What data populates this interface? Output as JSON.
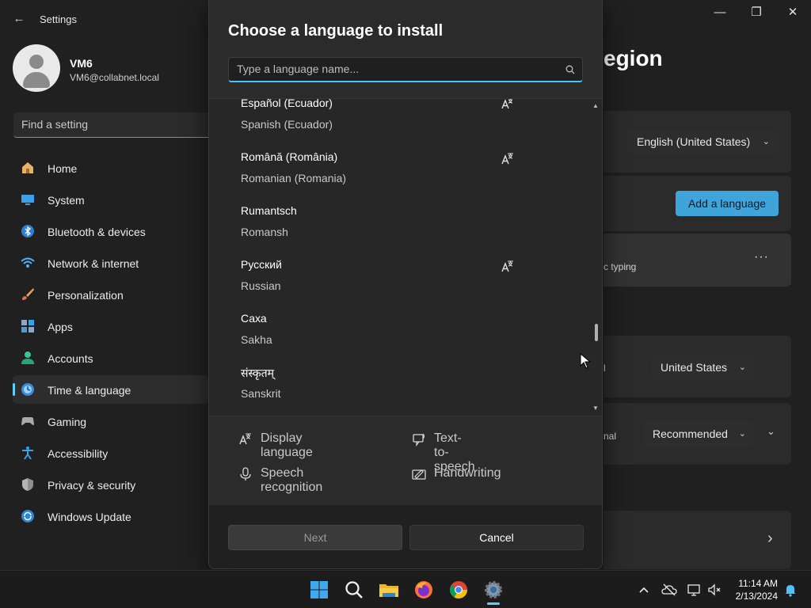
{
  "window": {
    "title": "Settings",
    "back_glyph": "←",
    "minimize_glyph": "—",
    "maximize_glyph": "❐",
    "close_glyph": "✕"
  },
  "profile": {
    "name": "VM6",
    "email": "VM6@collabnet.local"
  },
  "search": {
    "placeholder": "Find a setting"
  },
  "sidebar": {
    "items": [
      {
        "label": "Home",
        "icon": "home-icon"
      },
      {
        "label": "System",
        "icon": "system-icon"
      },
      {
        "label": "Bluetooth & devices",
        "icon": "bluetooth-icon"
      },
      {
        "label": "Network & internet",
        "icon": "wifi-icon"
      },
      {
        "label": "Personalization",
        "icon": "brush-icon"
      },
      {
        "label": "Apps",
        "icon": "apps-icon"
      },
      {
        "label": "Accounts",
        "icon": "accounts-icon"
      },
      {
        "label": "Time & language",
        "icon": "time-language-icon",
        "selected": true
      },
      {
        "label": "Gaming",
        "icon": "gaming-icon"
      },
      {
        "label": "Accessibility",
        "icon": "accessibility-icon"
      },
      {
        "label": "Privacy & security",
        "icon": "shield-icon"
      },
      {
        "label": "Windows Update",
        "icon": "windows-update-icon"
      }
    ]
  },
  "background_page": {
    "heading_fragment": "egion",
    "display_language_value": "English (United States)",
    "add_language_label": "Add a language",
    "typing_fragment": "c typing",
    "more_glyph": "···",
    "region_value": "United States",
    "region_fragment": "l",
    "format_fragment": "nal",
    "format_value": "Recommended",
    "chevron_down_glyph": "⌄",
    "chevron_right_glyph": "›"
  },
  "dialog": {
    "title": "Choose a language to install",
    "search_placeholder": "Type a language name...",
    "languages": [
      {
        "native": "Español (Ecuador)",
        "english": "Spanish (Ecuador)",
        "display_language": true
      },
      {
        "native": "Română (România)",
        "english": "Romanian (Romania)",
        "display_language": true
      },
      {
        "native": "Rumantsch",
        "english": "Romansh",
        "display_language": false
      },
      {
        "native": "Русский",
        "english": "Russian",
        "display_language": true
      },
      {
        "native": "Саха",
        "english": "Sakha",
        "display_language": false
      },
      {
        "native": "संस्कृतम्",
        "english": "Sanskrit",
        "display_language": false
      }
    ],
    "legend": [
      {
        "label": "Display language",
        "icon": "display-language-icon"
      },
      {
        "label": "Text-to-speech",
        "icon": "text-to-speech-icon"
      },
      {
        "label": "Speech recognition",
        "icon": "microphone-icon"
      },
      {
        "label": "Handwriting",
        "icon": "handwriting-icon"
      }
    ],
    "next_label": "Next",
    "cancel_label": "Cancel",
    "scroll_up_glyph": "▲",
    "scroll_down_glyph": "▼",
    "scroll_position": 0.78
  },
  "taskbar": {
    "time": "11:14 AM",
    "date": "2/13/2024",
    "apps": [
      "start-icon",
      "search-icon",
      "file-explorer-icon",
      "firefox-icon",
      "chrome-icon",
      "settings-icon"
    ]
  },
  "colors": {
    "accent": "#60cdff",
    "background": "#202020",
    "card": "#2b2b2b"
  }
}
